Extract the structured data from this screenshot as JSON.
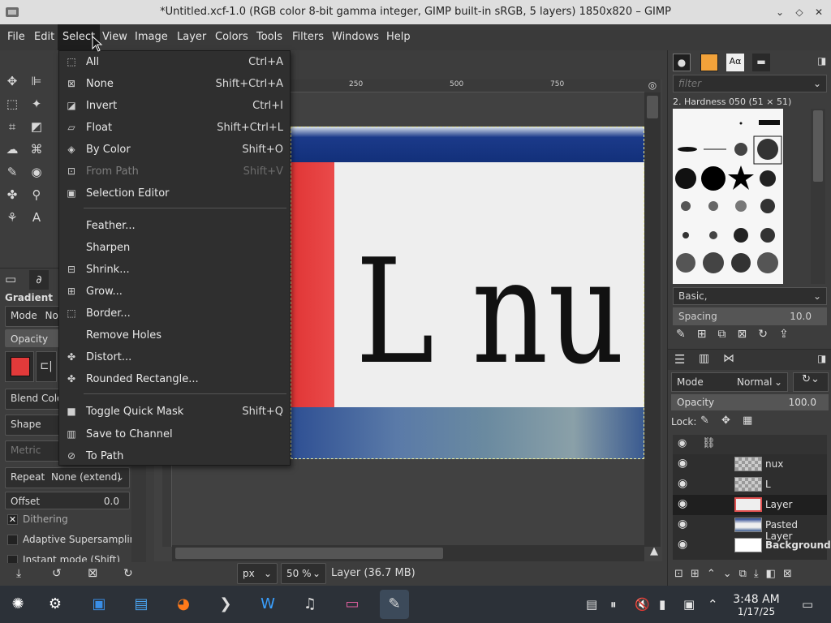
{
  "window": {
    "title": "*Untitled.xcf-1.0 (RGB color 8-bit gamma integer, GIMP built-in sRGB, 5 layers) 1850x820 – GIMP",
    "controls": [
      "⌄",
      "◇",
      "✕"
    ]
  },
  "menubar": {
    "items": [
      "File",
      "Edit",
      "Select",
      "View",
      "Image",
      "Layer",
      "Colors",
      "Tools",
      "Filters",
      "Windows",
      "Help"
    ],
    "active": "Select"
  },
  "select_menu": {
    "items": [
      {
        "label": "All",
        "shortcut": "Ctrl+A",
        "icon": "select-all-icon",
        "disabled": false
      },
      {
        "label": "None",
        "shortcut": "Shift+Ctrl+A",
        "icon": "select-none-icon",
        "disabled": false
      },
      {
        "label": "Invert",
        "shortcut": "Ctrl+I",
        "icon": "invert-selection-icon",
        "disabled": false
      },
      {
        "label": "Float",
        "shortcut": "Shift+Ctrl+L",
        "icon": "float-icon",
        "disabled": false
      },
      {
        "label": "By Color",
        "shortcut": "Shift+O",
        "icon": "by-color-icon",
        "disabled": false
      },
      {
        "label": "From Path",
        "shortcut": "Shift+V",
        "icon": "from-path-icon",
        "disabled": true
      },
      {
        "label": "Selection Editor",
        "shortcut": "",
        "icon": "selection-editor-icon",
        "disabled": false
      },
      {
        "separator": true
      },
      {
        "label": "Feather...",
        "shortcut": "",
        "icon": "",
        "disabled": false
      },
      {
        "label": "Sharpen",
        "shortcut": "",
        "icon": "",
        "disabled": false
      },
      {
        "label": "Shrink...",
        "shortcut": "",
        "icon": "shrink-icon",
        "disabled": false
      },
      {
        "label": "Grow...",
        "shortcut": "",
        "icon": "grow-icon",
        "disabled": false
      },
      {
        "label": "Border...",
        "shortcut": "",
        "icon": "border-icon",
        "disabled": false
      },
      {
        "label": "Remove Holes",
        "shortcut": "",
        "icon": "",
        "disabled": false
      },
      {
        "label": "Distort...",
        "shortcut": "",
        "icon": "distort-icon",
        "disabled": false
      },
      {
        "label": "Rounded Rectangle...",
        "shortcut": "",
        "icon": "rounded-rect-icon",
        "disabled": false
      },
      {
        "separator": true
      },
      {
        "label": "Toggle Quick Mask",
        "shortcut": "Shift+Q",
        "icon": "quick-mask-icon",
        "disabled": false
      },
      {
        "label": "Save to Channel",
        "shortcut": "",
        "icon": "save-channel-icon",
        "disabled": false
      },
      {
        "label": "To Path",
        "shortcut": "",
        "icon": "to-path-icon",
        "disabled": false
      }
    ]
  },
  "tool_options": {
    "title": "Gradient",
    "mode_label": "Mode",
    "mode_value": "Norr",
    "opacity_label": "Opacity",
    "blend_color_label": "Blend Color",
    "shape_label": "Shape",
    "metric_label": "Metric",
    "repeat_label": "Repeat",
    "repeat_value": "None (extend)",
    "offset_label": "Offset",
    "offset_value": "0.0",
    "dithering": "Dithering",
    "adaptive": "Adaptive Supersampling",
    "instant": "Instant mode (Shift)"
  },
  "ruler": {
    "ticks": [
      "250",
      "500",
      "750"
    ]
  },
  "canvas": {
    "text": "L nu"
  },
  "statusbar": {
    "unit": "px",
    "zoom": "50 %",
    "layer_info": "Layer (36.7 MB)"
  },
  "brushes": {
    "filter_placeholder": "filter",
    "selected": "2. Hardness 050 (51 × 51)",
    "preset": "Basic,",
    "spacing_label": "Spacing",
    "spacing_value": "10.0"
  },
  "layers_panel": {
    "mode_label": "Mode",
    "mode_value": "Normal",
    "opacity_label": "Opacity",
    "opacity_value": "100.0",
    "lock_label": "Lock:",
    "layers": [
      {
        "name": "nux",
        "bold": false
      },
      {
        "name": "L",
        "bold": false
      },
      {
        "name": "Layer",
        "bold": false
      },
      {
        "name": "Pasted Layer",
        "bold": false
      },
      {
        "name": "Background",
        "bold": true
      }
    ]
  },
  "taskbar": {
    "time": "3:48 AM",
    "date": "1/17/25"
  },
  "colors": {
    "accent": "#3c4a5a",
    "fg_swatch": "#e23a3a"
  }
}
